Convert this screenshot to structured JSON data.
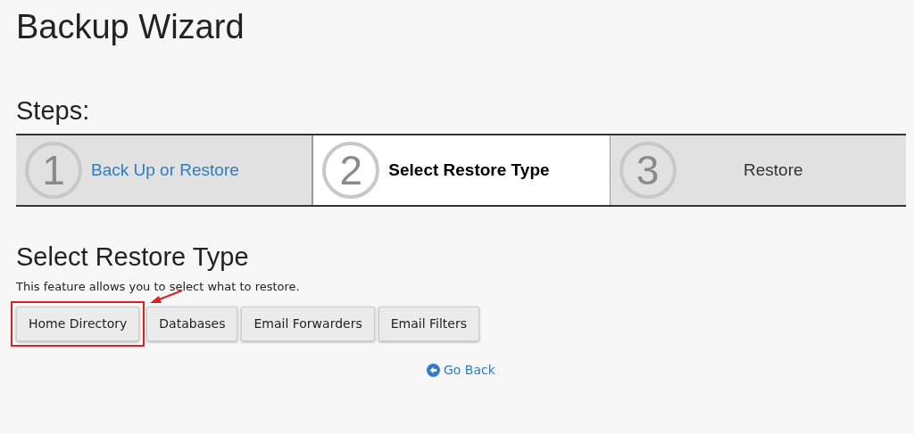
{
  "page": {
    "title": "Backup Wizard",
    "steps_heading": "Steps:"
  },
  "steps": [
    {
      "number": "1",
      "label": "Back Up or Restore",
      "completed": true,
      "selected": false
    },
    {
      "number": "2",
      "label": "Select Restore Type",
      "completed": false,
      "selected": true
    },
    {
      "number": "3",
      "label": "Restore",
      "completed": false,
      "selected": false
    }
  ],
  "section": {
    "title": "Select Restore Type",
    "description": "This feature allows you to select what to restore."
  },
  "buttons": [
    {
      "label": "Home Directory",
      "highlighted": true
    },
    {
      "label": "Databases",
      "highlighted": false
    },
    {
      "label": "Email Forwarders",
      "highlighted": false
    },
    {
      "label": "Email Filters",
      "highlighted": false
    }
  ],
  "go_back": {
    "label": "Go Back"
  }
}
